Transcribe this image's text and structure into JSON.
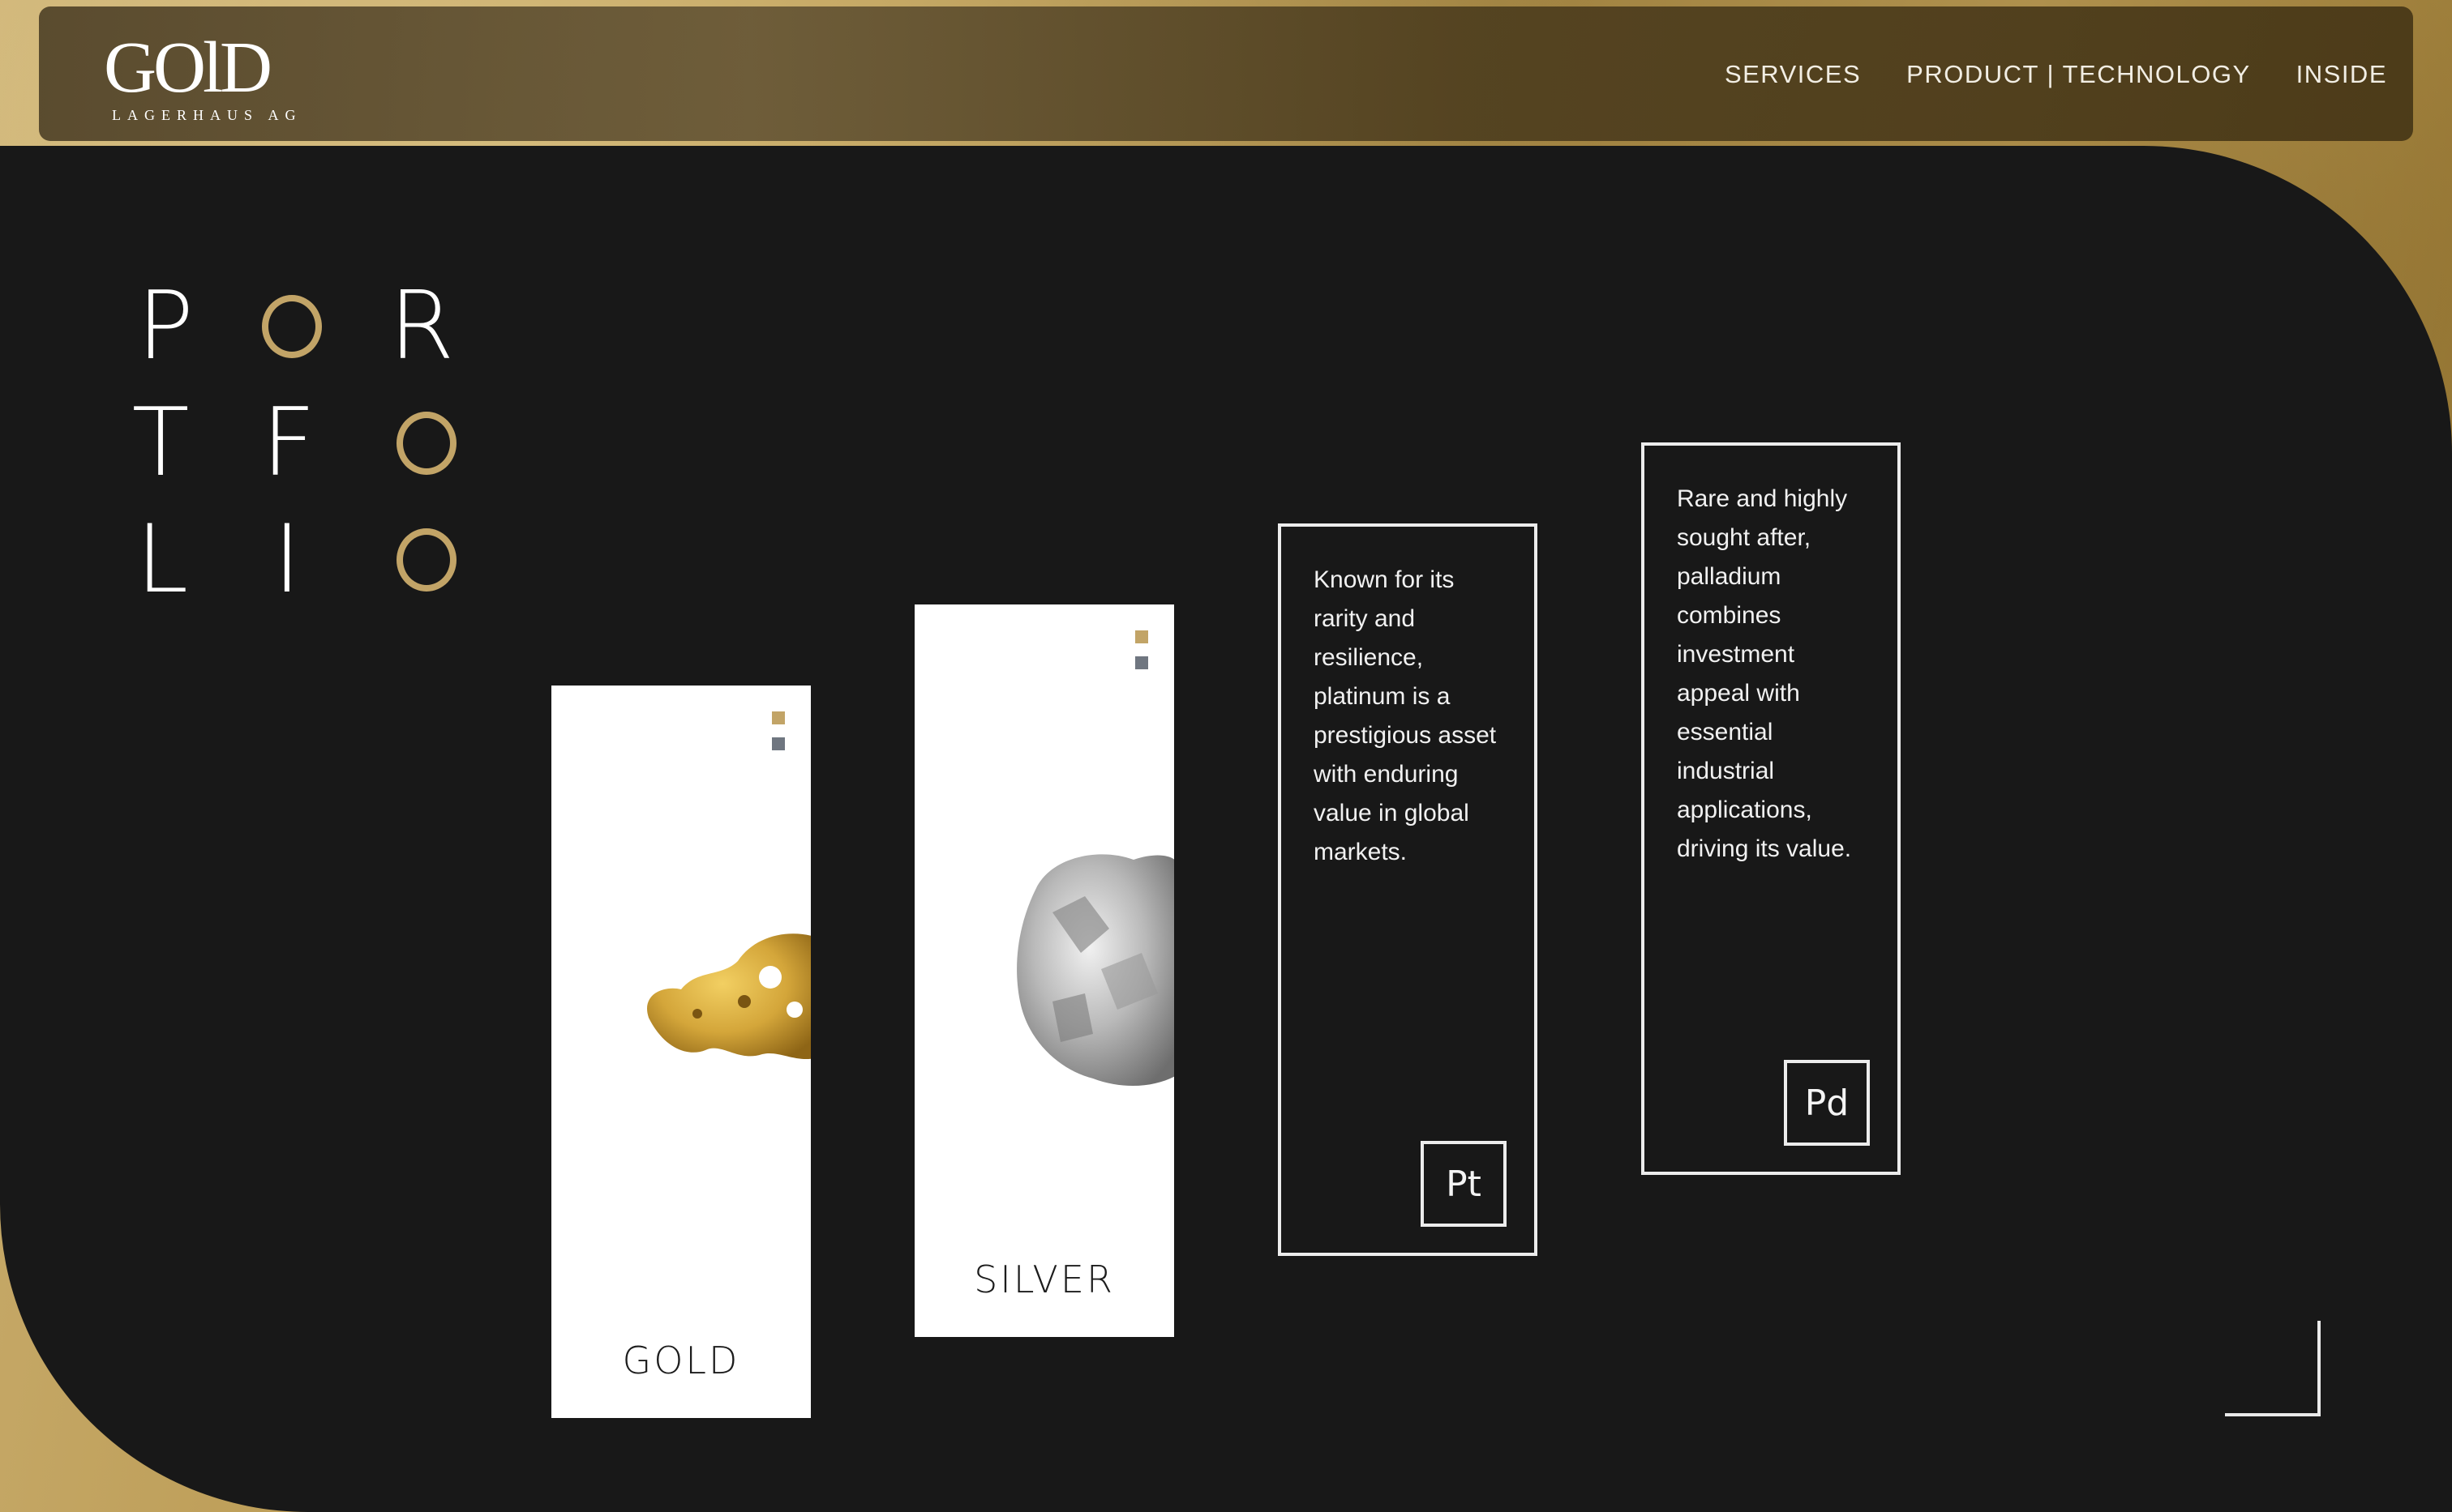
{
  "header": {
    "logo_main": "GOlD",
    "logo_sub": "LAGERHAUS AG",
    "nav": [
      "SERVICES",
      "PRODUCT | TECHNOLOGY",
      "INSIDE"
    ]
  },
  "portfolio": {
    "letters": [
      "P",
      "O",
      "R",
      "T",
      "F",
      "O",
      "L",
      "I",
      "O"
    ]
  },
  "cards": {
    "gold": {
      "label": "GOLD"
    },
    "silver": {
      "label": "SILVER"
    },
    "platinum": {
      "text": "Known for its rarity and resilience, platinum is a prestigious asset with enduring value in global markets.",
      "symbol": "Pt"
    },
    "palladium": {
      "text": "Rare and highly sought after, palladium combines investment appeal with essential industrial applications, driving its value.",
      "symbol": "Pd"
    }
  },
  "colors": {
    "accent_gold": "#c2a467",
    "accent_grey": "#6f7680",
    "panel_bg": "#181818"
  }
}
